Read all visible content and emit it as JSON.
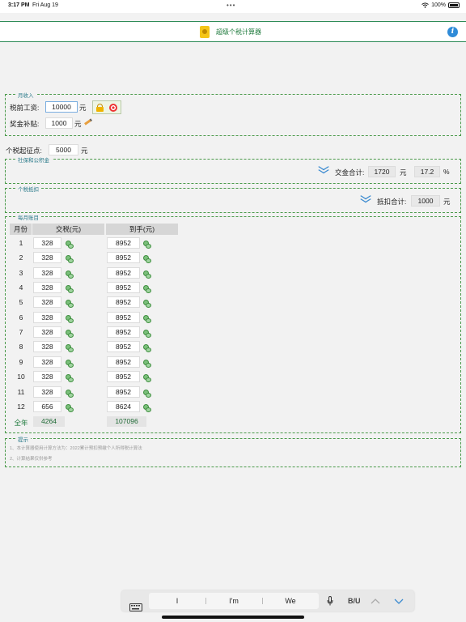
{
  "status": {
    "time": "3:17 PM",
    "date": "Fri Aug 19",
    "battery": "100%"
  },
  "nav": {
    "title": "超级个税计算器",
    "info": "i"
  },
  "income": {
    "legend": "月收入",
    "salary_label": "税前工资:",
    "salary_value": "10000",
    "salary_unit": "元",
    "bonus_label": "奖金补贴:",
    "bonus_value": "1000",
    "bonus_unit": "元"
  },
  "threshold": {
    "label": "个税起征点:",
    "value": "5000",
    "unit": "元"
  },
  "insurance": {
    "legend": "社保和公积金",
    "total_label": "交金合计:",
    "total_value": "1720",
    "unit": "元",
    "rate_value": "17.2",
    "rate_unit": "%"
  },
  "deduction": {
    "legend": "个税抵扣",
    "total_label": "抵扣合计:",
    "total_value": "1000",
    "unit": "元"
  },
  "monthly": {
    "legend": "每月账目",
    "headers": {
      "month": "月份",
      "tax": "交税(元)",
      "net": "到手(元)"
    },
    "rows": [
      {
        "month": "1",
        "tax": "328",
        "net": "8952"
      },
      {
        "month": "2",
        "tax": "328",
        "net": "8952"
      },
      {
        "month": "3",
        "tax": "328",
        "net": "8952"
      },
      {
        "month": "4",
        "tax": "328",
        "net": "8952"
      },
      {
        "month": "5",
        "tax": "328",
        "net": "8952"
      },
      {
        "month": "6",
        "tax": "328",
        "net": "8952"
      },
      {
        "month": "7",
        "tax": "328",
        "net": "8952"
      },
      {
        "month": "8",
        "tax": "328",
        "net": "8952"
      },
      {
        "month": "9",
        "tax": "328",
        "net": "8952"
      },
      {
        "month": "10",
        "tax": "328",
        "net": "8952"
      },
      {
        "month": "11",
        "tax": "328",
        "net": "8952"
      },
      {
        "month": "12",
        "tax": "656",
        "net": "8624"
      }
    ],
    "total_label": "全年",
    "total_tax": "4264",
    "total_net": "107096"
  },
  "tips": {
    "legend": "提示",
    "items": [
      "1、本计算器使用计算方法为：2022累计预扣预缴个人所得税计算法",
      "2、计算结果仅供参考"
    ]
  },
  "keyboard": {
    "suggestions": [
      "I",
      "I'm",
      "We"
    ],
    "format": "B/U"
  },
  "colors": {
    "accent_green": "#2e8b57",
    "info_blue": "#2f8bd8",
    "chevron_blue": "#3a8ad0"
  }
}
